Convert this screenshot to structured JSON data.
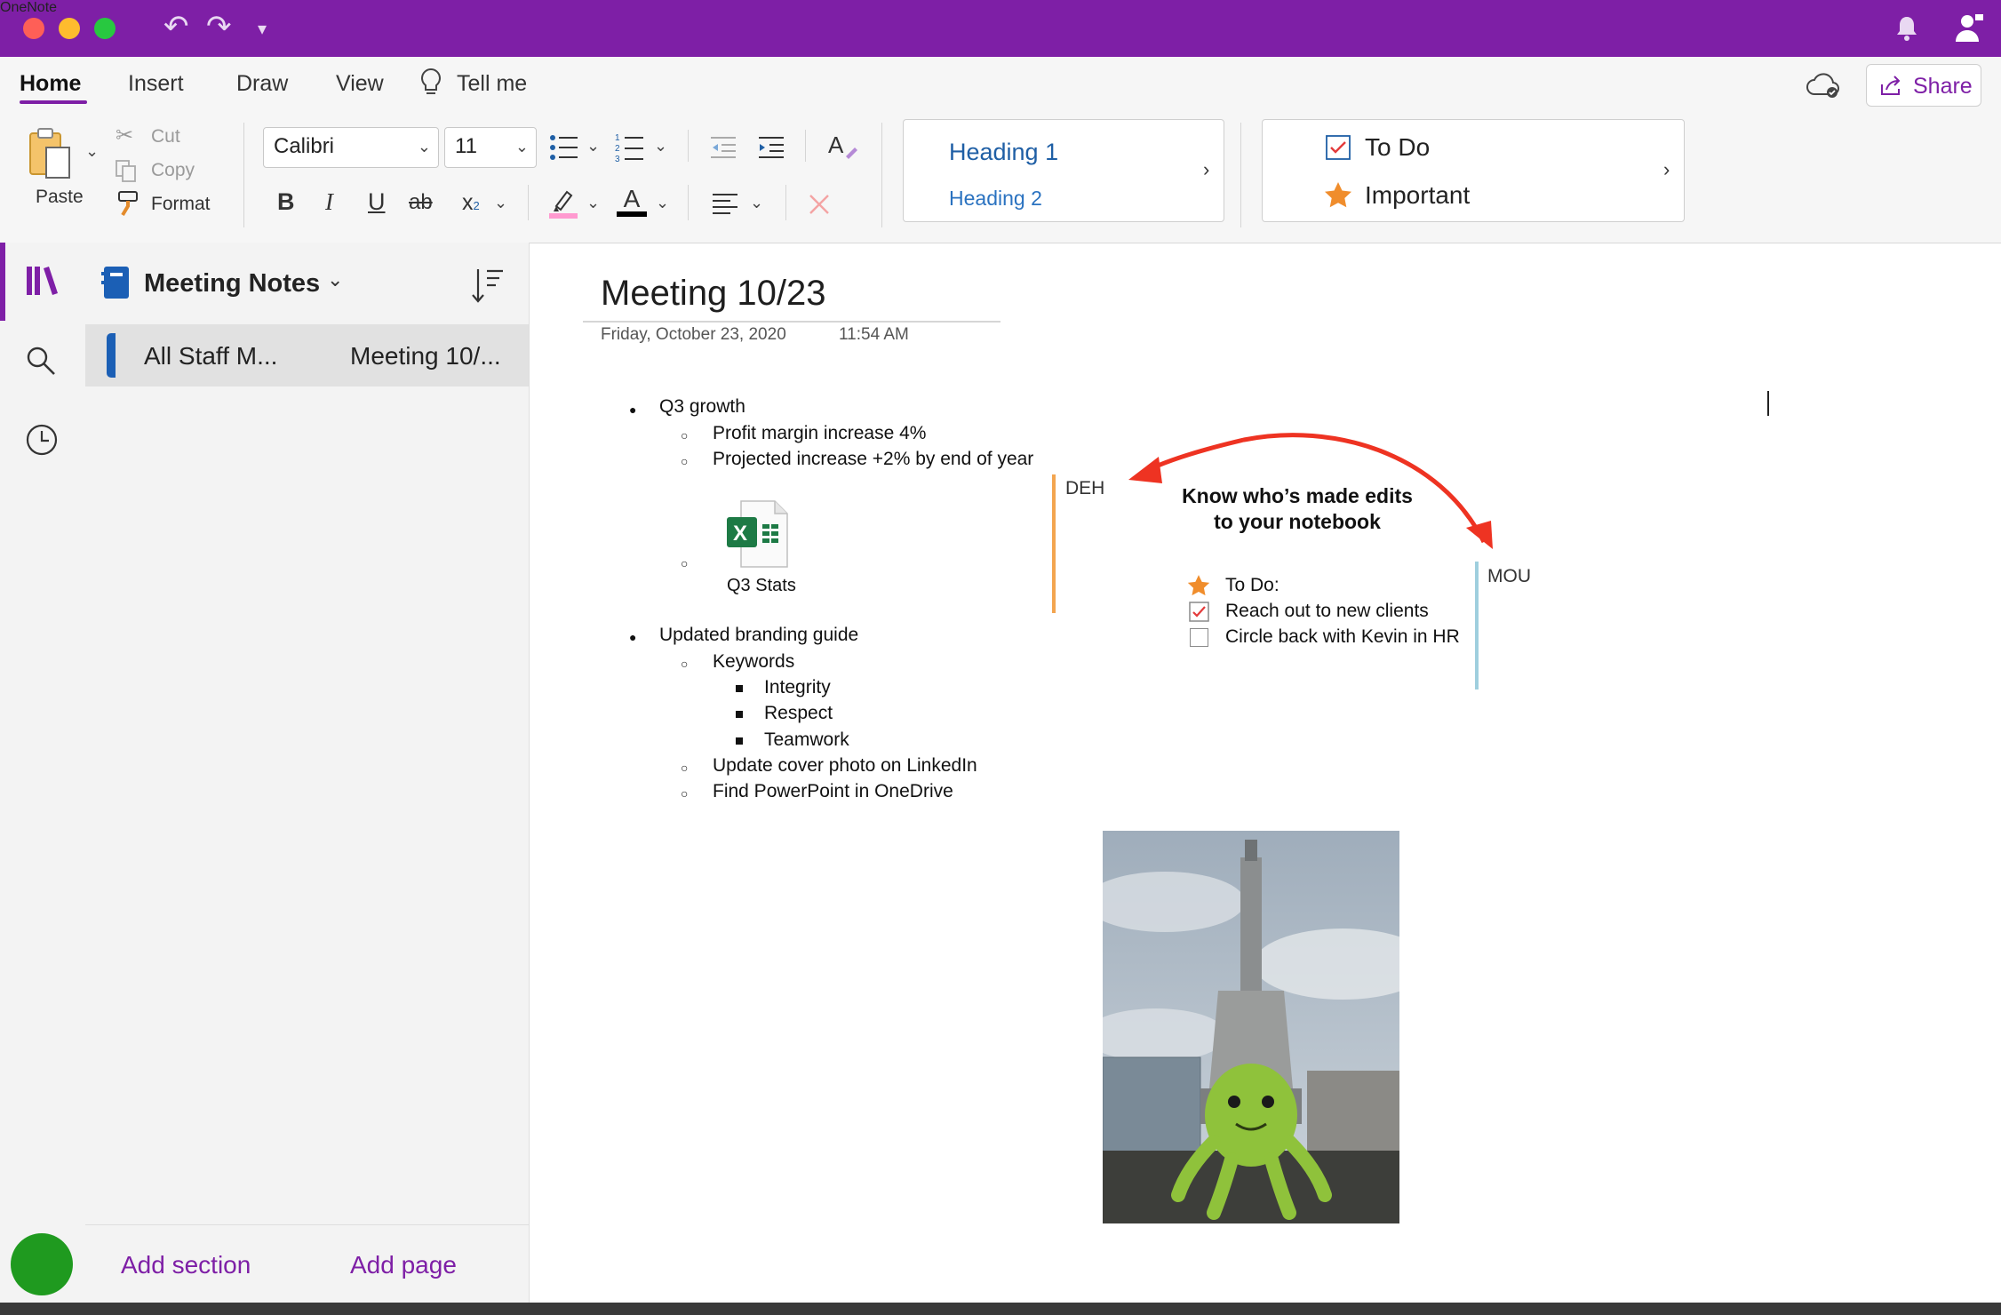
{
  "app": {
    "title": "OneNote",
    "accent_color": "#7e1fa6",
    "traffic_colors": [
      "#fe5f57",
      "#febc2e",
      "#28c840"
    ]
  },
  "ribbon_tabs": [
    "Home",
    "Insert",
    "Draw",
    "View"
  ],
  "tell_me": "Tell me",
  "share_label": "Share",
  "clipboard": {
    "paste": "Paste",
    "cut": "Cut",
    "copy": "Copy",
    "format": "Format"
  },
  "font": {
    "family": "Calibri",
    "size": "11"
  },
  "format_buttons": {
    "bold": "B",
    "italic": "I",
    "underline": "U",
    "strike": "ab",
    "subscript": "x",
    "font_color_letter": "A",
    "highlight_color": "#ff9ad0",
    "font_color": "#000000"
  },
  "styles": {
    "heading1": "Heading 1",
    "heading2": "Heading 2",
    "heading_color": "#1f5fa5"
  },
  "tags": {
    "todo": "To Do",
    "important": "Important"
  },
  "notebook": {
    "name": "Meeting Notes",
    "section": "All Staff M...",
    "page": "Meeting 10/...",
    "add_section": "Add section",
    "add_page": "Add page",
    "section_color": "#1b5fb5"
  },
  "page": {
    "title": "Meeting 10/23",
    "date": "Friday, October 23, 2020",
    "time": "11:54 AM",
    "items": {
      "q3": "Q3 growth",
      "profit": "Profit margin increase 4%",
      "projected": "Projected increase +2% by end of year",
      "attachment": "Q3 Stats",
      "branding": "Updated branding guide",
      "keywords": "Keywords",
      "integrity": "Integrity",
      "respect": "Respect",
      "teamwork": "Teamwork",
      "cover": "Update cover photo on LinkedIn",
      "ppt": "Find PowerPoint in OneDrive"
    },
    "authors": {
      "a1": "DEH",
      "a1_color": "#f3a550",
      "a2": "MOU",
      "a2_color": "#9fcfde"
    },
    "callout_line1": "Know who’s made edits",
    "callout_line2": "to your notebook",
    "todo": {
      "label": "To Do:",
      "item1": "Reach out to new clients",
      "item1_checked": true,
      "item2": "Circle back with Kevin in HR",
      "item2_checked": false
    }
  },
  "avatar_color": "#1f9a1f"
}
